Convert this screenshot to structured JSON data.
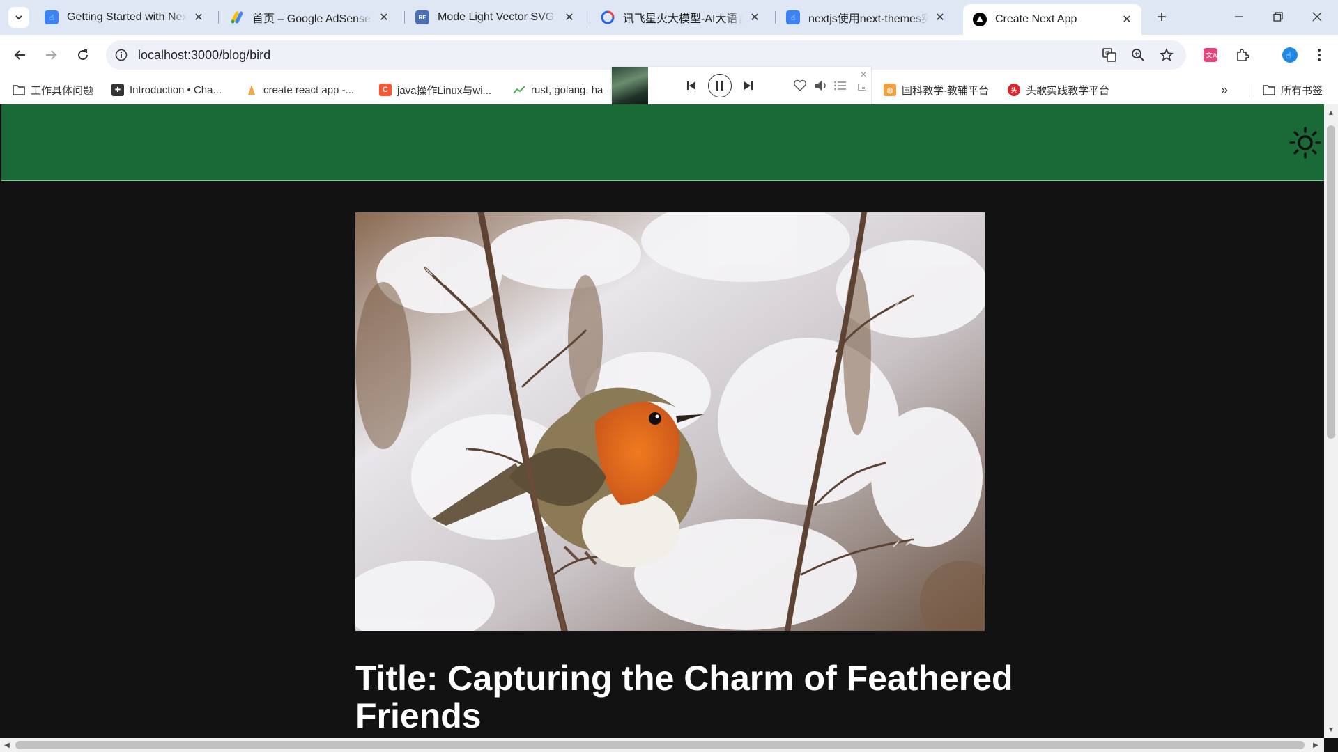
{
  "browser": {
    "tabs": [
      {
        "title": "Getting Started with Next.js",
        "favicon": "hand-pointer-icon",
        "active": false
      },
      {
        "title": "首页 – Google AdSense",
        "favicon": "adsense-icon",
        "active": false
      },
      {
        "title": "Mode Light Vector SVG Icon",
        "favicon": "svgrepo-icon",
        "active": false
      },
      {
        "title": "讯飞星火大模型-AI大语言模型",
        "favicon": "spark-icon",
        "active": false
      },
      {
        "title": "nextjs使用next-themes实现",
        "favicon": "hand-pointer-icon",
        "active": false
      },
      {
        "title": "Create Next App",
        "favicon": "nextjs-triangle-icon",
        "active": true
      }
    ],
    "url": "localhost:3000/blog/bird"
  },
  "bookmarks": [
    {
      "label": "工作具体问题",
      "icon": "folder-icon"
    },
    {
      "label": "Introduction • Cha...",
      "icon": "chakra-icon"
    },
    {
      "label": "create react app -...",
      "icon": "cra-icon"
    },
    {
      "label": "java操作Linux与wi...",
      "icon": "csdn-icon"
    },
    {
      "label": "rust, golang, ha",
      "icon": "trend-icon"
    },
    {
      "label": "国科教学-教辅平台",
      "icon": "guoke-icon"
    },
    {
      "label": "头歌实践教学平台",
      "icon": "touge-icon"
    },
    {
      "label": "所有书签",
      "icon": "folder-icon"
    }
  ],
  "media_controls": {
    "state": "playing"
  },
  "page": {
    "header_color": "#1a6a37",
    "background_color": "#121212",
    "hero_image": "robin-bird-on-snowy-branch",
    "title": "Title: Capturing the Charm of Feathered Friends"
  }
}
